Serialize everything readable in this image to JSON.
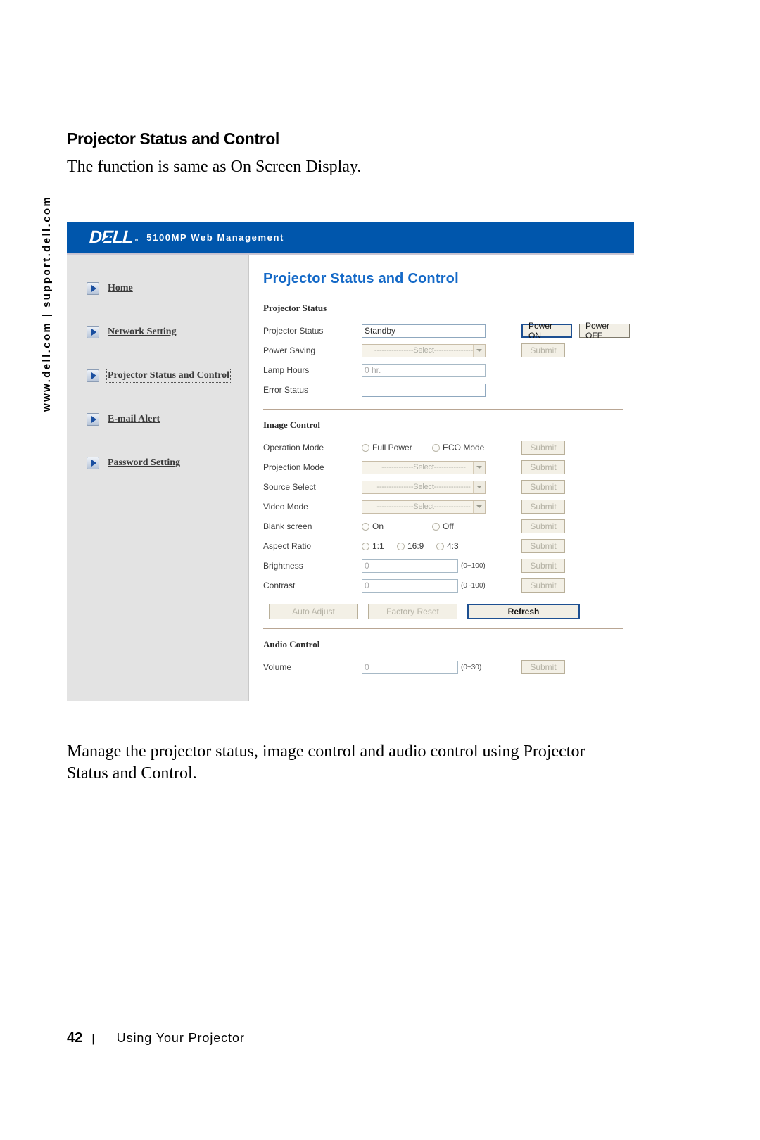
{
  "side_rail": "www.dell.com | support.dell.com",
  "page": {
    "heading": "Projector Status and Control",
    "intro": "The function is same as On Screen Display.",
    "closing": "Manage the projector status, image control and audio control using Projector Status and Control.",
    "footer_page_number": "42",
    "footer_separator": "|",
    "footer_section": "Using Your Projector"
  },
  "webui": {
    "brand": {
      "logo_d": "D",
      "logo_o": "E",
      "logo_ll": "LL",
      "trademark": "™",
      "title": "5100MP Web Management",
      "bar_color": "#0056ac"
    },
    "nav": {
      "items": [
        {
          "label": "Home",
          "icon": "play-arrow-icon",
          "current": false
        },
        {
          "label": "Network Setting",
          "icon": "play-arrow-icon",
          "current": false
        },
        {
          "label": "Projector Status and Control",
          "icon": "play-arrow-icon",
          "current": true
        },
        {
          "label": "E-mail Alert",
          "icon": "play-arrow-icon",
          "current": false
        },
        {
          "label": "Password Setting",
          "icon": "play-arrow-icon",
          "current": false
        }
      ]
    },
    "main": {
      "title": "Projector Status and Control",
      "title_color": "#1469c7",
      "projector_status": {
        "section_label": "Projector Status",
        "rows": {
          "projector_status": {
            "label": "Projector Status",
            "value": "Standby"
          },
          "power_saving": {
            "label": "Power Saving",
            "value": "----------------Select----------------"
          },
          "lamp_hours": {
            "label": "Lamp Hours",
            "value": "0 hr."
          },
          "error_status": {
            "label": "Error Status",
            "value": ""
          }
        },
        "buttons": {
          "power_on": "Power ON",
          "power_off": "Power OFF",
          "submit": "Submit"
        }
      },
      "image_control": {
        "section_label": "Image Control",
        "rows": {
          "operation_mode": {
            "label": "Operation Mode",
            "options": [
              "Full Power",
              "ECO Mode"
            ],
            "submit": "Submit"
          },
          "projection_mode": {
            "label": "Projection Mode",
            "value": "-------------Select-------------",
            "submit": "Submit"
          },
          "source_select": {
            "label": "Source Select",
            "value": "---------------Select---------------",
            "submit": "Submit"
          },
          "video_mode": {
            "label": "Video Mode",
            "value": "---------------Select---------------",
            "submit": "Submit"
          },
          "blank_screen": {
            "label": "Blank screen",
            "options": [
              "On",
              "Off"
            ],
            "submit": "Submit"
          },
          "aspect_ratio": {
            "label": "Aspect Ratio",
            "options": [
              "1:1",
              "16:9",
              "4:3"
            ],
            "submit": "Submit"
          },
          "brightness": {
            "label": "Brightness",
            "value": "0",
            "range": "(0~100)",
            "submit": "Submit"
          },
          "contrast": {
            "label": "Contrast",
            "value": "0",
            "range": "(0~100)",
            "submit": "Submit"
          }
        },
        "action_buttons": {
          "auto_adjust": "Auto Adjust",
          "factory_reset": "Factory Reset",
          "refresh": "Refresh"
        }
      },
      "audio_control": {
        "section_label": "Audio Control",
        "rows": {
          "volume": {
            "label": "Volume",
            "value": "0",
            "range": "(0~30)",
            "submit": "Submit"
          }
        }
      }
    }
  }
}
